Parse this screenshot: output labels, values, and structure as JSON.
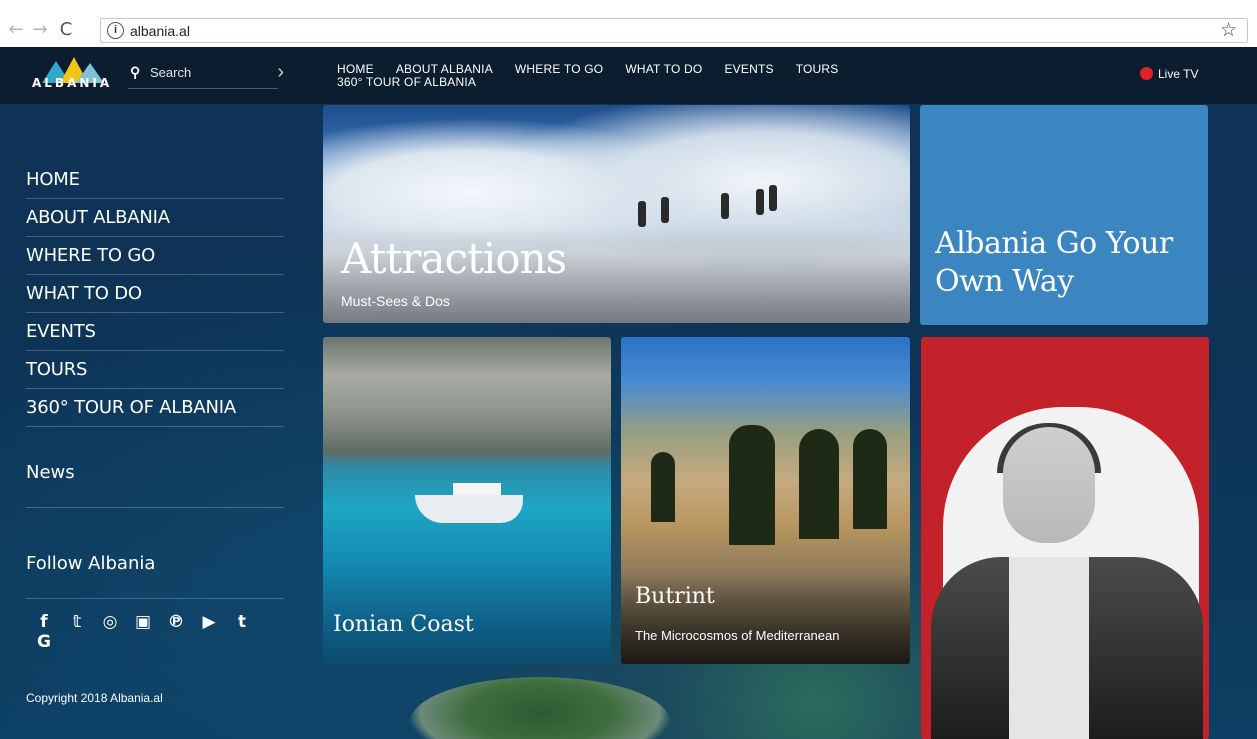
{
  "browser": {
    "back": "←",
    "forward": "→",
    "reload": "C",
    "info": "i",
    "url": "albania.al",
    "star": "☆"
  },
  "header": {
    "logo_text": "ALBANIA",
    "search_label": "Search",
    "search_arrow": "›",
    "nav": [
      "HOME",
      "ABOUT ALBANIA",
      "WHERE TO GO",
      "WHAT TO DO",
      "EVENTS",
      "TOURS"
    ],
    "nav_second": "360° TOUR OF ALBANIA",
    "live_tv": "Live TV"
  },
  "sidebar": {
    "items": [
      "HOME",
      "ABOUT ALBANIA",
      "WHERE TO GO",
      "WHAT TO DO",
      "EVENTS",
      "TOURS",
      "360° TOUR OF ALBANIA"
    ],
    "news": "News",
    "follow": "Follow Albania",
    "social": [
      "f",
      "𝕥",
      "◎",
      "▣",
      "℗",
      "▶",
      "t",
      "G"
    ],
    "copyright": "Copyright 2018 Albania.al"
  },
  "tiles": {
    "attractions": {
      "title": "Attractions",
      "subtitle": "Must-Sees & Dos"
    },
    "promo": {
      "title": "Albania Go Your Own Way"
    },
    "ionian": {
      "title": "Ionian Coast"
    },
    "butrint": {
      "title": "Butrint",
      "subtitle": "The Microcosmos of Mediterranean"
    }
  },
  "colors": {
    "accent_blue": "#3b86c0",
    "accent_red": "#c3222a",
    "live_dot": "#e0202a"
  }
}
